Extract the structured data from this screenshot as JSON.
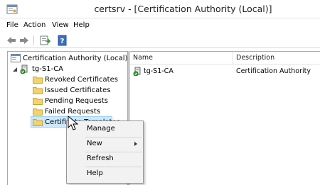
{
  "window": {
    "title": "certsrv - [Certification Authority (Local)]"
  },
  "menubar": {
    "items": [
      "File",
      "Action",
      "View",
      "Help"
    ]
  },
  "toolbar": {
    "buttons": [
      "back-icon",
      "forward-icon",
      "export-list-icon",
      "help-icon"
    ]
  },
  "tree": {
    "root": "Certification Authority (Local)",
    "ca": "tg-S1-CA",
    "children": [
      "Revoked Certificates",
      "Issued Certificates",
      "Pending Requests",
      "Failed Requests",
      "Certificate Templates"
    ],
    "selected": "Certificate Templates"
  },
  "list": {
    "columns": [
      "Name",
      "Description"
    ],
    "rows": [
      {
        "name": "tg-S1-CA",
        "description": "Certification Authority"
      }
    ]
  },
  "context_menu": {
    "items": [
      "Manage",
      "New",
      "Refresh",
      "Help"
    ]
  },
  "colors": {
    "selection_bg": "#cce8ff",
    "selection_border": "#99d1ff",
    "folder_yellow": "#f3d36b",
    "help_blue": "#3b6fc4"
  }
}
